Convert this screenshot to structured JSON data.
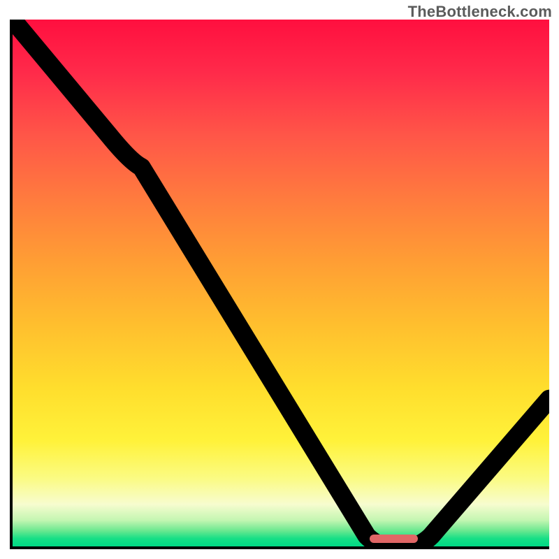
{
  "watermark": "TheBottleneck.com",
  "chart_data": {
    "type": "line",
    "title": "",
    "xlabel": "",
    "ylabel": "",
    "xlim": [
      0,
      100
    ],
    "ylim": [
      0,
      100
    ],
    "grid": false,
    "legend": false,
    "series": [
      {
        "name": "bottleneck-curve",
        "x": [
          0,
          18,
          24,
          66,
          70,
          74,
          100
        ],
        "values": [
          100,
          78,
          72,
          2,
          0,
          0,
          28
        ]
      }
    ],
    "background_gradient": {
      "orientation": "vertical",
      "stops": [
        {
          "pos": 0.0,
          "color": "#ff0f3f"
        },
        {
          "pos": 0.22,
          "color": "#ff5648"
        },
        {
          "pos": 0.46,
          "color": "#ff9e34"
        },
        {
          "pos": 0.7,
          "color": "#ffde2d"
        },
        {
          "pos": 0.87,
          "color": "#fbfb82"
        },
        {
          "pos": 0.95,
          "color": "#c4f6b2"
        },
        {
          "pos": 1.0,
          "color": "#00d985"
        }
      ]
    },
    "marker": {
      "name": "optimal-range",
      "x_start": 68,
      "x_end": 76,
      "y": 1,
      "color": "#e06666"
    }
  }
}
